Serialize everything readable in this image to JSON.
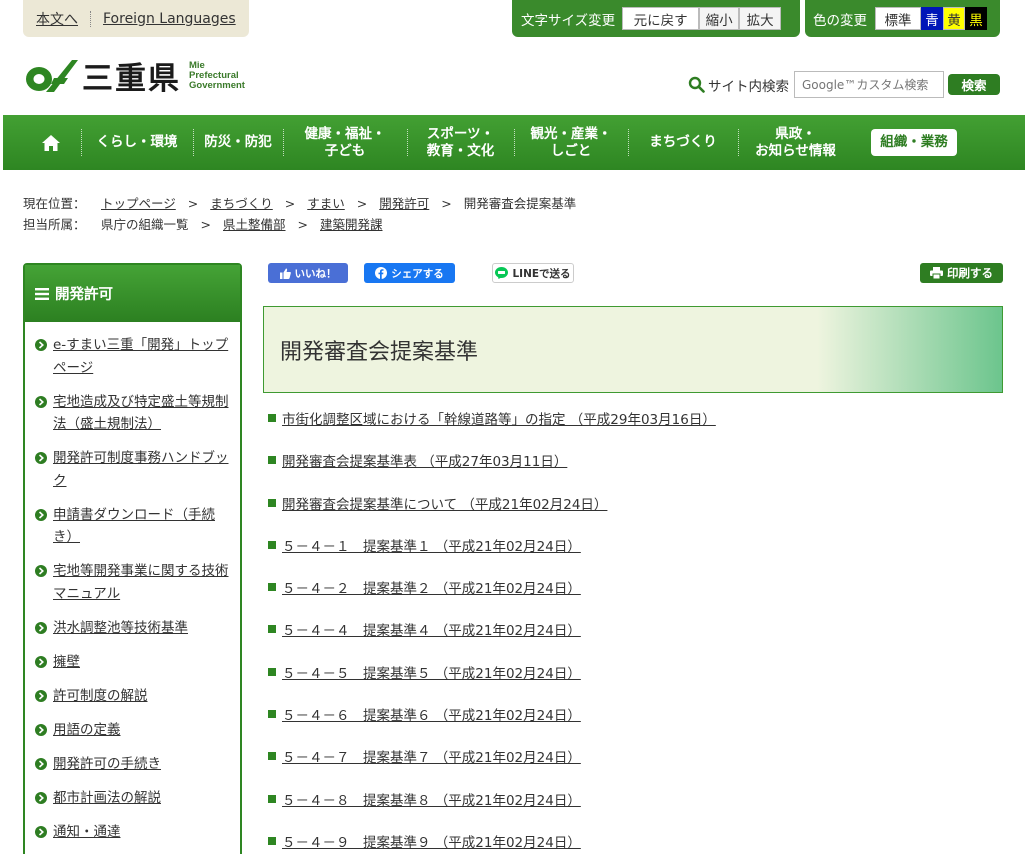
{
  "util": {
    "skip_label": "本文へ",
    "foreign_label": "Foreign Languages",
    "fontsize_label": "文字サイズ変更",
    "fontsize_reset": "元に戻す",
    "fontsize_small": "縮小",
    "fontsize_big": "拡大",
    "color_label": "色の変更",
    "color_std": "標準",
    "color_blue": "青",
    "color_yellow": "黄",
    "color_black": "黒"
  },
  "logo": {
    "kanji": "三重県",
    "en_line1": "Mie",
    "en_line2": "Prefectural",
    "en_line3": "Government"
  },
  "search": {
    "label": "サイト内検索",
    "placeholder": "Google™カスタム検索",
    "button": "検索"
  },
  "gnav": [
    {
      "l1": "くらし・環境",
      "l2": ""
    },
    {
      "l1": "防災・防犯",
      "l2": ""
    },
    {
      "l1": "健康・福祉・",
      "l2": "子ども"
    },
    {
      "l1": "スポーツ・",
      "l2": "教育・文化"
    },
    {
      "l1": "観光・産業・",
      "l2": "しごと"
    },
    {
      "l1": "まちづくり",
      "l2": ""
    },
    {
      "l1": "県政・",
      "l2": "お知らせ情報"
    }
  ],
  "gnav_org": "組織・業務",
  "breadcrumb": {
    "current_label": "現在位置：",
    "items": [
      "トップページ",
      "まちづくり",
      "すまい",
      "開発許可"
    ],
    "current": "開発審査会提案基準",
    "gt": ">",
    "dept_label": "担当所属：",
    "dept_items": [
      "県庁の組織一覧",
      "県土整備部",
      "建築開発課"
    ]
  },
  "sidebar": {
    "title": "開発許可",
    "items": [
      "e-すまい三重「開発」トップページ",
      "宅地造成及び特定盛土等規制法（盛土規制法）",
      "開発許可制度事務ハンドブック",
      "申請書ダウンロード（手続き）",
      "宅地等開発事業に関する技術マニュアル",
      "洪水調整池等技術基準",
      "擁壁",
      "許可制度の解説",
      "用語の定義",
      "開発許可の手続き",
      "都市計画法の解説",
      "通知・通達"
    ]
  },
  "social": {
    "like": "いいね！",
    "share": "シェアする",
    "line": "LINEで送る",
    "print": "印刷する"
  },
  "main": {
    "title": "開発審査会提案基準",
    "links": [
      "市街化調整区域における「幹線道路等」の指定 （平成29年03月16日）",
      "開発審査会提案基準表 （平成27年03月11日）",
      "開発審査会提案基準について （平成21年02月24日）",
      "５－４－１　提案基準１ （平成21年02月24日）",
      "５－４－２　提案基準２ （平成21年02月24日）",
      "５－４－４　提案基準４ （平成21年02月24日）",
      "５－４－５　提案基準５ （平成21年02月24日）",
      "５－４－６　提案基準６ （平成21年02月24日）",
      "５－４－７　提案基準７ （平成21年02月24日）",
      "５－４－８　提案基準８ （平成21年02月24日）",
      "５－４－９　提案基準９ （平成21年02月24日）"
    ]
  },
  "colors": {
    "brand_green": "#2e8622",
    "title_bg": "#eef4df"
  }
}
